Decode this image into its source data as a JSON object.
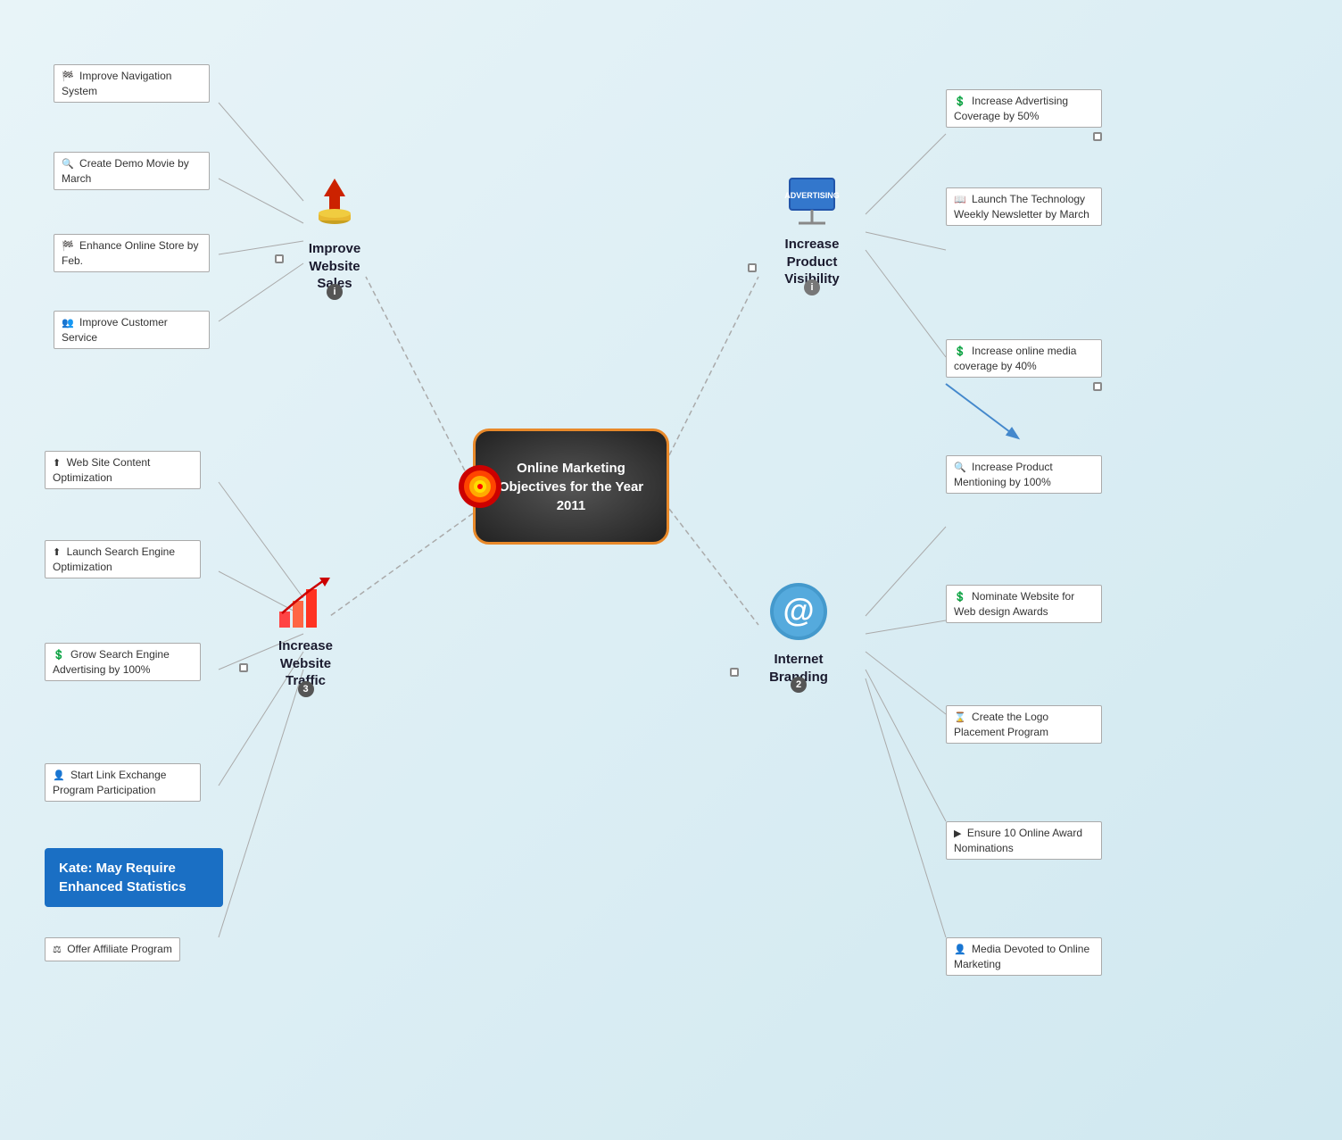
{
  "center": {
    "title": "Online Marketing Objectives for the Year 2011"
  },
  "branches": {
    "improve_website_sales": {
      "label": "Improve\nWebsite\nSales",
      "icon": "💰",
      "badge": "i",
      "subtopics": [
        {
          "icon": "🏁",
          "text": "Improve Navigation System"
        },
        {
          "icon": "🔍",
          "text": "Create Demo Movie by March"
        },
        {
          "icon": "🏁",
          "text": "Enhance Online Store by Feb."
        },
        {
          "icon": "👥",
          "text": "Improve Customer Service"
        }
      ]
    },
    "increase_product_visibility": {
      "label": "Increase\nProduct\nVisibility",
      "icon": "📋",
      "badge": "i",
      "subtopics": [
        {
          "icon": "💲",
          "text": "Increase Advertising Coverage by 50%"
        },
        {
          "icon": "📖",
          "text": "Launch The Technology Weekly Newsletter by March"
        },
        {
          "icon": "💲",
          "text": "Increase online media coverage by 40%"
        }
      ]
    },
    "internet_branding": {
      "label": "Internet\nBranding",
      "icon": "@",
      "badge": "2",
      "subtopics": [
        {
          "icon": "🔍",
          "text": "Increase Product Mentioning by 100%"
        },
        {
          "icon": "💲",
          "text": "Nominate Website for Web design Awards"
        },
        {
          "icon": "⌛",
          "text": "Create the Logo Placement Program"
        },
        {
          "icon": "▶",
          "text": "Ensure 10 Online Award Nominations"
        },
        {
          "icon": "👤",
          "text": "Media Devoted to Online Marketing"
        }
      ]
    },
    "increase_website_traffic": {
      "label": "Increase\nWebsite\nTraffic",
      "icon": "📊",
      "badge": "3",
      "subtopics": [
        {
          "icon": "⬆",
          "text": "Web Site Content Optimization"
        },
        {
          "icon": "⬆",
          "text": "Launch Search Engine Optimization"
        },
        {
          "icon": "💲",
          "text": "Grow Search Engine Advertising by 100%"
        },
        {
          "icon": "👤",
          "text": "Start Link Exchange Program Participation"
        },
        {
          "icon": "⚖",
          "text": "Offer Affiliate Program"
        }
      ]
    }
  },
  "note": {
    "text": "Kate: May Require\nEnhanced\nStatistics"
  }
}
